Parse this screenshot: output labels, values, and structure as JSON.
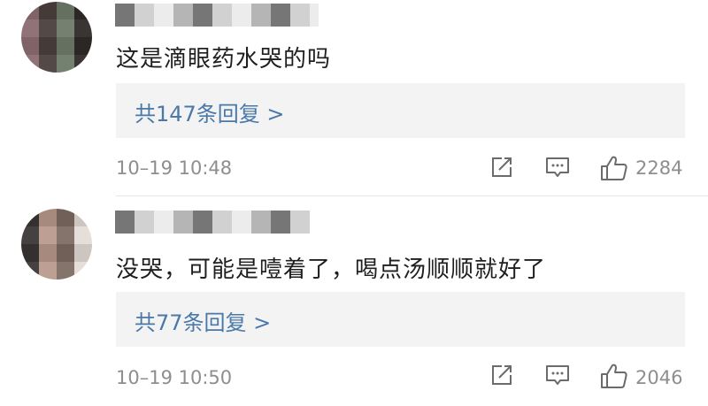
{
  "comments": [
    {
      "text": "这是滴眼药水哭的吗",
      "replies_label": "共147条回复 >",
      "time": "10–19 10:48",
      "likes": "2284"
    },
    {
      "text": "没哭，可能是噎着了，喝点汤顺顺就好了",
      "replies_label": "共77条回复 >",
      "time": "10–19 10:50",
      "likes": "2046"
    }
  ]
}
